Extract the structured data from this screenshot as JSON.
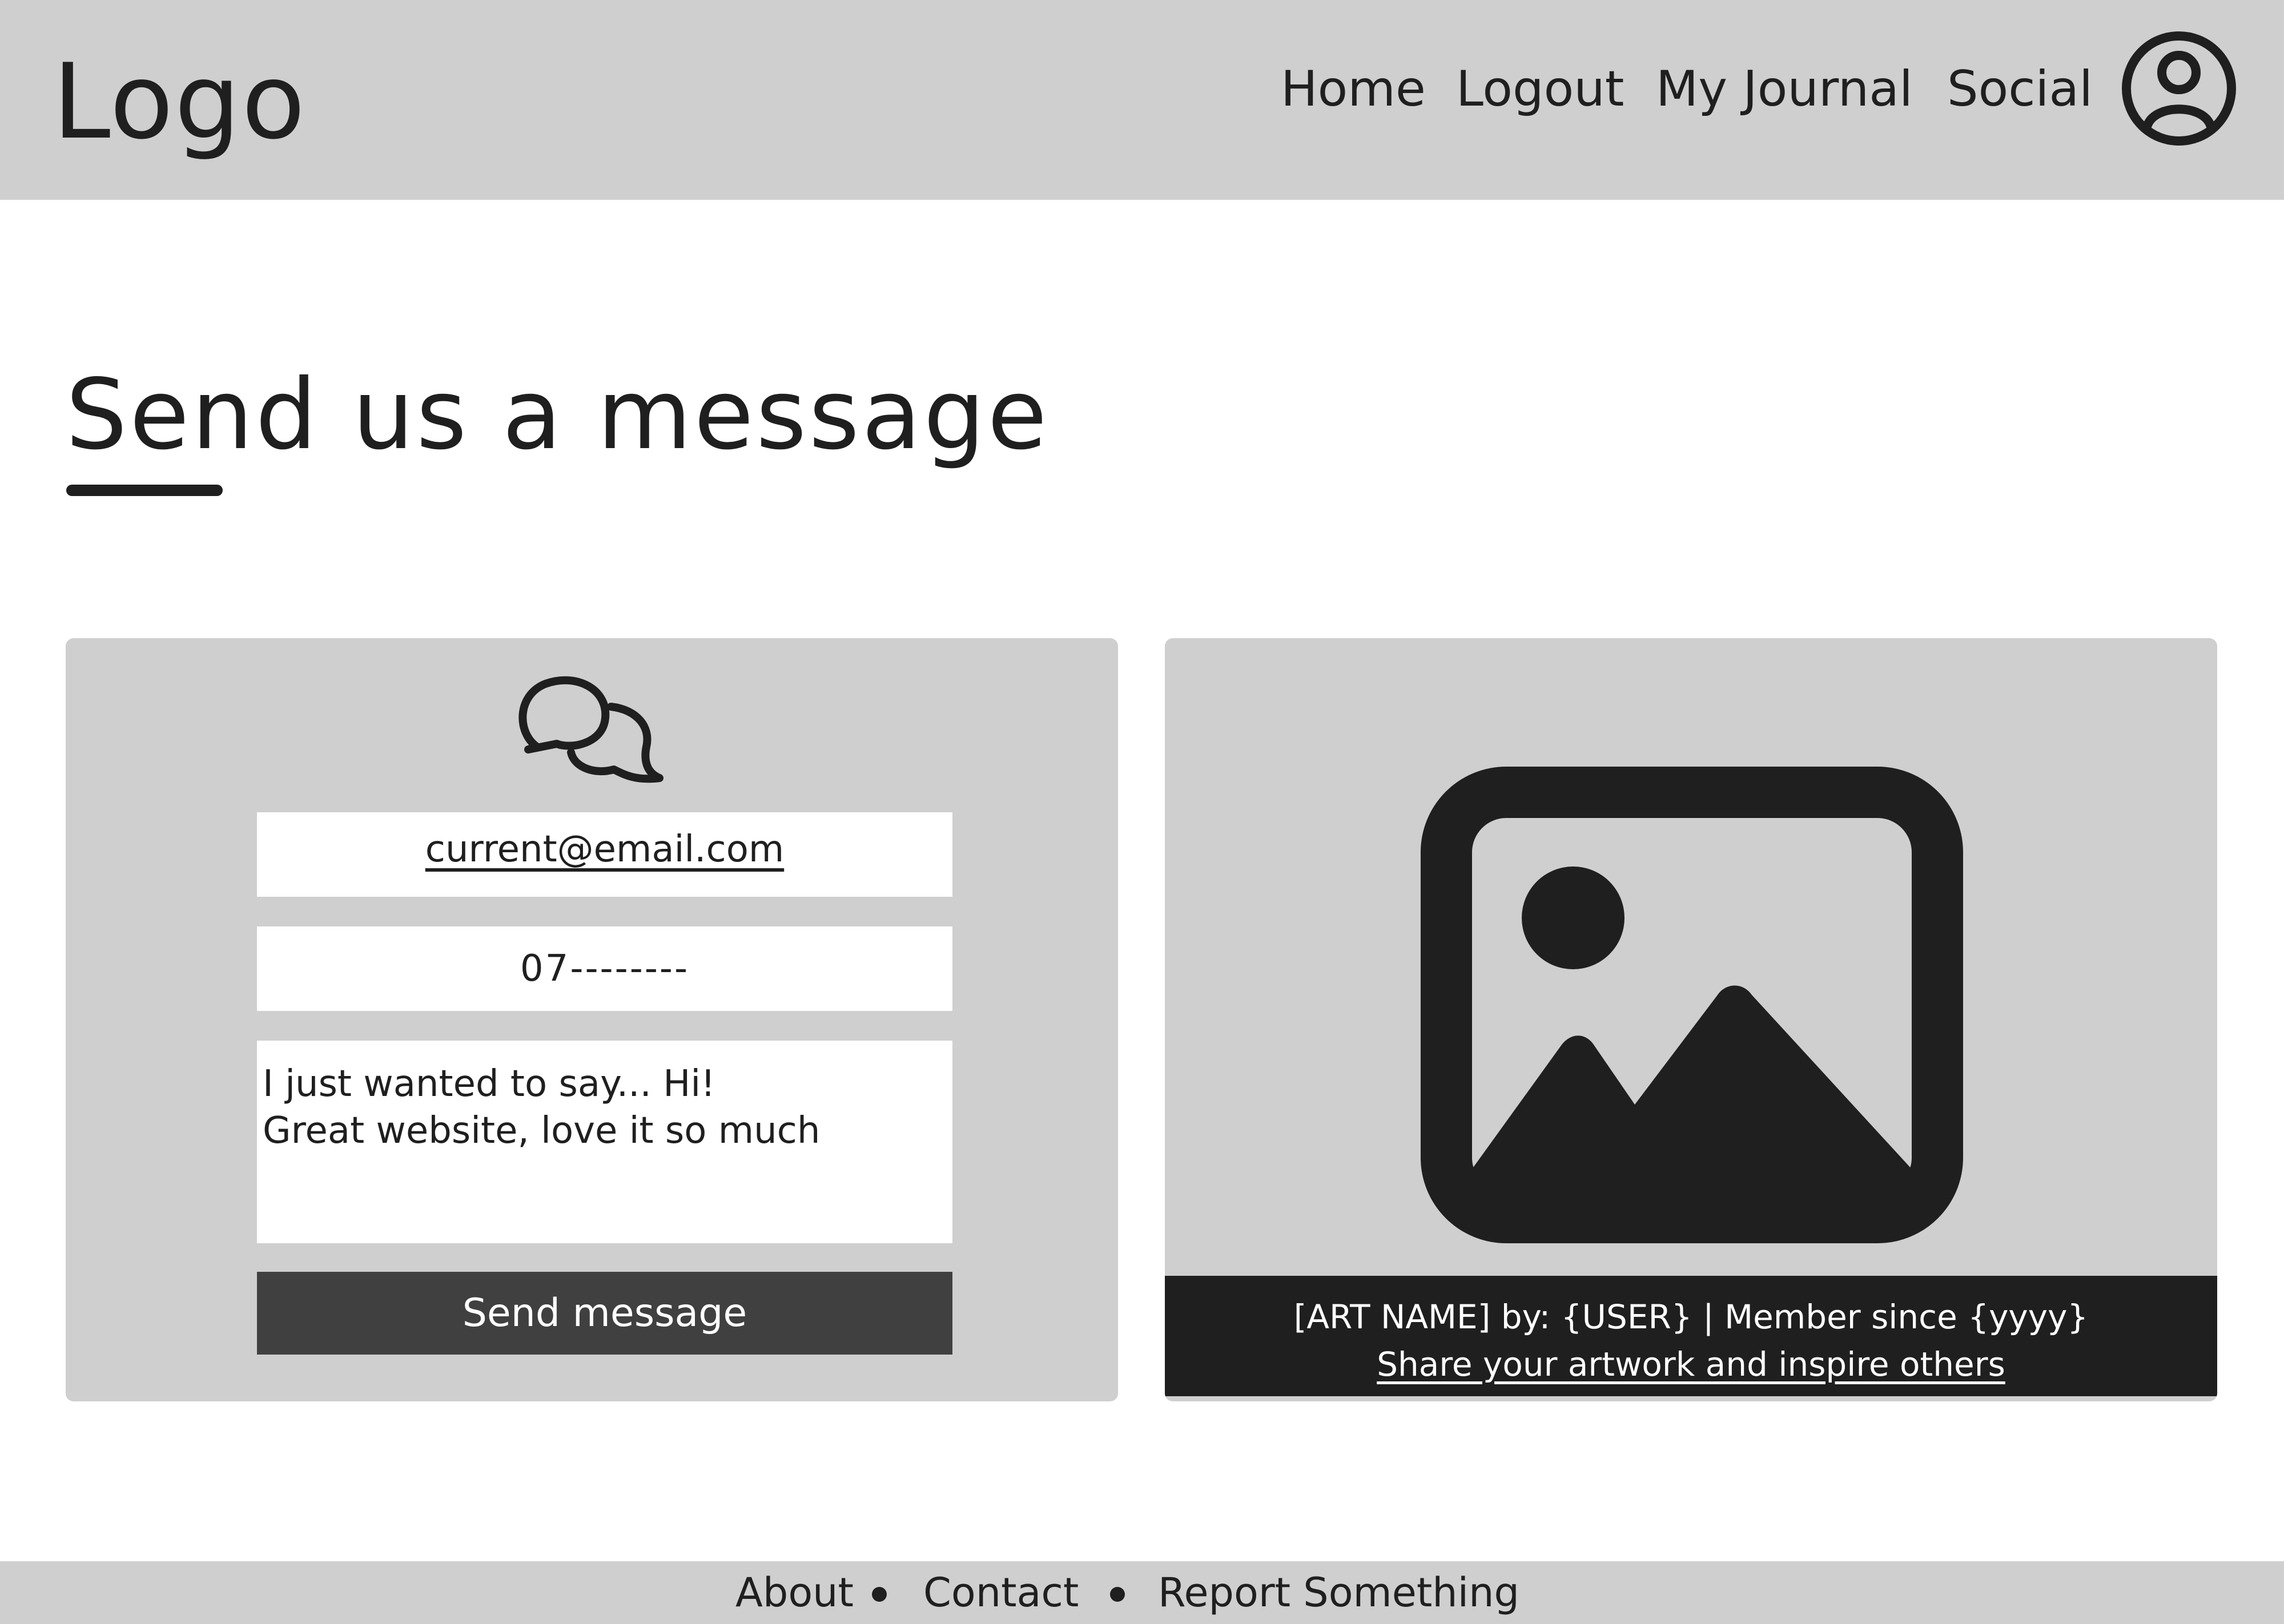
{
  "header": {
    "logo": "Logo",
    "nav": [
      "Home",
      "Logout",
      "My Journal",
      "Social"
    ],
    "profile_icon": "user-circle-icon"
  },
  "page": {
    "title": "Send us a message"
  },
  "contact_form": {
    "icon": "chat-bubbles-icon",
    "email_value": "current@email.com",
    "phone_value": "07--------",
    "message_value": "I just wanted to say... Hi!\nGreat website, love it so much",
    "submit_label": "Send message"
  },
  "artwork": {
    "icon": "image-icon",
    "caption": "[ART NAME] by: {USER} | Member since {yyyy}",
    "link": "Share your artwork and inspire others"
  },
  "footer": {
    "links": [
      "About",
      "Contact",
      "Report Something"
    ]
  },
  "colors": {
    "chrome": "#cfcfcf",
    "dark": "#1f1f1f",
    "button": "#404040",
    "background": "#ffffff"
  }
}
